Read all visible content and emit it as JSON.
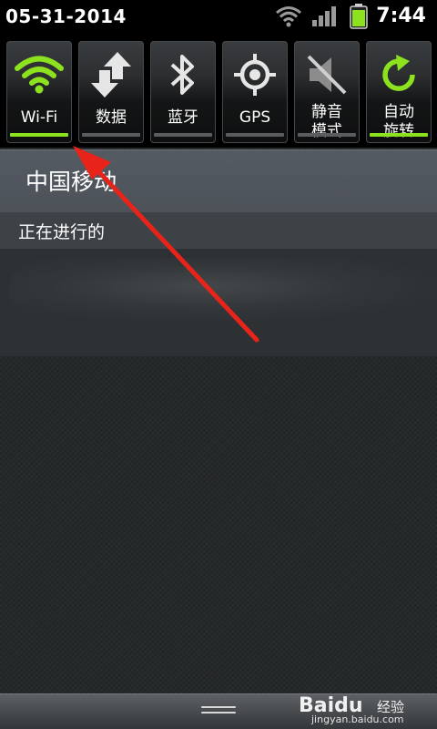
{
  "status_bar": {
    "date": "05-31-2014",
    "time": "7:44",
    "icons": [
      "wifi-signal-icon",
      "cell-signal-icon",
      "battery-icon"
    ]
  },
  "quick_settings": {
    "toggles": [
      {
        "label": "Wi-Fi",
        "icon": "wifi-icon",
        "active": true
      },
      {
        "label": "数据",
        "icon": "data-transfer-icon",
        "active": false
      },
      {
        "label": "蓝牙",
        "icon": "bluetooth-icon",
        "active": false
      },
      {
        "label": "GPS",
        "icon": "gps-icon",
        "active": false
      },
      {
        "label": "静音\n模式",
        "icon": "mute-icon",
        "active": false
      },
      {
        "label": "自动\n旋转",
        "icon": "rotate-icon",
        "active": true
      }
    ]
  },
  "carrier": {
    "name": "中国移动"
  },
  "notifications": {
    "ongoing_header": "正在进行的"
  },
  "watermark": {
    "logo": "Baidu",
    "name": "经验",
    "url": "jingyan.baidu.com"
  },
  "colors": {
    "accent_green": "#8de21f",
    "annotation_red": "#e8241a",
    "carrier_bar": "#555b63"
  }
}
